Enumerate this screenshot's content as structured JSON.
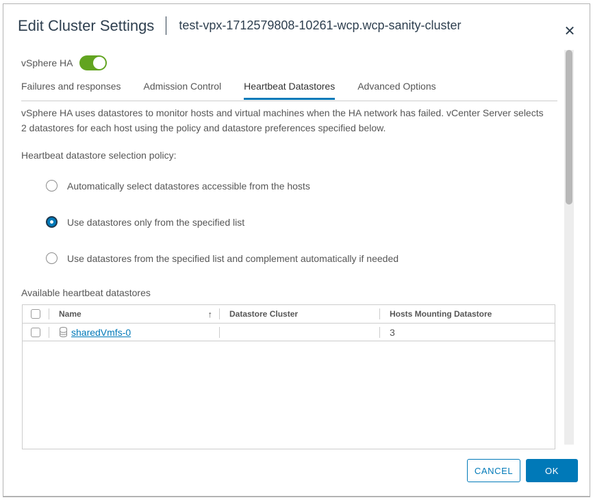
{
  "dialog": {
    "title": "Edit Cluster Settings",
    "subtitle": "test-vpx-1712579808-10261-wcp.wcp-sanity-cluster",
    "close_label": "✕"
  },
  "ha_toggle": {
    "label": "vSphere HA",
    "state": "on"
  },
  "tabs": [
    {
      "label": "Failures and responses",
      "active": false
    },
    {
      "label": "Admission Control",
      "active": false
    },
    {
      "label": "Heartbeat Datastores",
      "active": true
    },
    {
      "label": "Advanced Options",
      "active": false
    }
  ],
  "body": {
    "description": "vSphere HA uses datastores to monitor hosts and virtual machines when the HA network has failed. vCenter Server selects 2 datastores for each host using the policy and datastore preferences specified below.",
    "policy_label": "Heartbeat datastore selection policy:"
  },
  "policy_options": [
    {
      "label": "Automatically select datastores accessible from the hosts",
      "selected": false
    },
    {
      "label": "Use datastores only from the specified list",
      "selected": true
    },
    {
      "label": "Use datastores from the specified list and complement automatically if needed",
      "selected": false
    }
  ],
  "table": {
    "title": "Available heartbeat datastores",
    "sort_indicator": "↑",
    "columns": [
      {
        "label": "Name"
      },
      {
        "label": "Datastore Cluster"
      },
      {
        "label": "Hosts Mounting Datastore"
      }
    ],
    "rows": [
      {
        "checked": false,
        "name": "sharedVmfs-0",
        "datastore_cluster": "",
        "hosts_mounting": "3"
      }
    ]
  },
  "footer": {
    "cancel_label": "CANCEL",
    "ok_label": "OK"
  },
  "colors": {
    "accent_blue": "#0079b8",
    "toggle_green": "#62a420",
    "title_text": "#2e3f4f",
    "body_text": "#565656",
    "border": "#cccccc"
  }
}
